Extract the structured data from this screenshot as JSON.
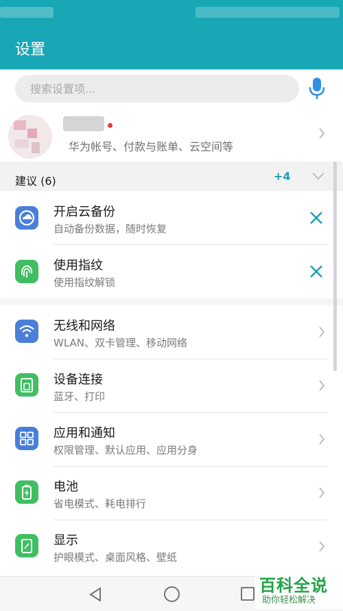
{
  "header": {
    "title": "设置"
  },
  "search": {
    "placeholder": "搜索设置项..."
  },
  "account": {
    "subtitle": "华为帐号、付款与账单、云空间等"
  },
  "suggestions": {
    "title": "建议 (6)",
    "more_count": "+4",
    "items": [
      {
        "title": "开启云备份",
        "subtitle": "自动备份数据，随时恢复",
        "icon": "cloud-backup-icon"
      },
      {
        "title": "使用指纹",
        "subtitle": "使用指纹解锁",
        "icon": "fingerprint-icon"
      }
    ]
  },
  "settings": [
    {
      "title": "无线和网络",
      "subtitle": "WLAN、双卡管理、移动网络",
      "icon": "wifi-icon"
    },
    {
      "title": "设备连接",
      "subtitle": "蓝牙、打印",
      "icon": "device-connection-icon"
    },
    {
      "title": "应用和通知",
      "subtitle": "权限管理、默认应用、应用分身",
      "icon": "apps-icon"
    },
    {
      "title": "电池",
      "subtitle": "省电模式、耗电排行",
      "icon": "battery-icon"
    },
    {
      "title": "显示",
      "subtitle": "护眼模式、桌面风格、壁纸",
      "icon": "display-icon"
    }
  ],
  "watermark": {
    "title": "百科全说",
    "subtitle": "助你轻松解决"
  },
  "colors": {
    "header": "#17a7b5",
    "accent": "#17a0ae",
    "blue_icon": "#4a7fd9",
    "green_icon": "#3fbf62"
  }
}
